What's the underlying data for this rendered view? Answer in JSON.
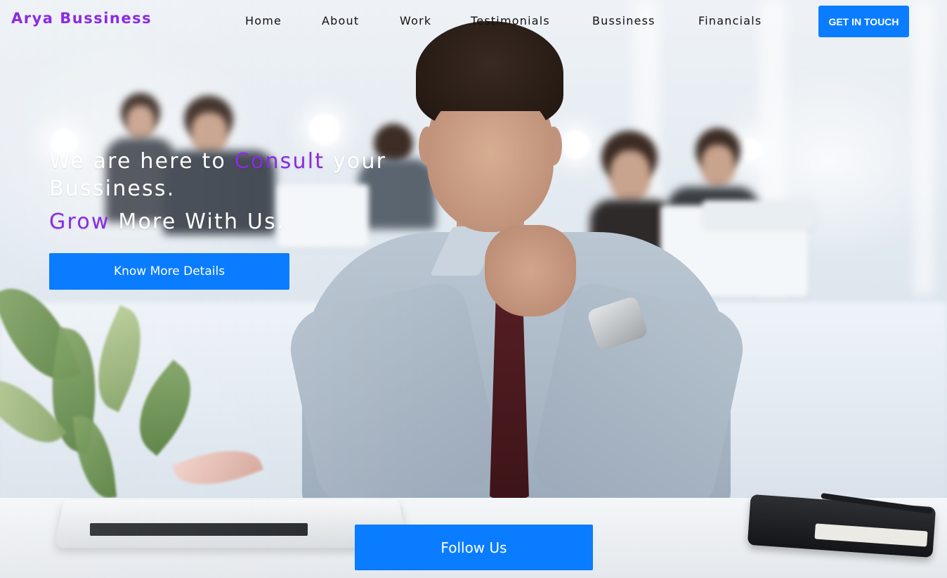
{
  "brand": {
    "name": "Arya Bussiness"
  },
  "nav": {
    "items": [
      {
        "label": "Home"
      },
      {
        "label": "About"
      },
      {
        "label": "Work"
      },
      {
        "label": "Testimonials"
      },
      {
        "label": "Bussiness"
      },
      {
        "label": "Financials"
      }
    ],
    "cta_label": "GET IN TOUCH"
  },
  "hero": {
    "line1_part1": "We are here to ",
    "line1_accent": "Consult",
    "line1_part2": " your Bussiness.",
    "line2_accent": "Grow",
    "line2_part2": " More With Us.",
    "details_button": "Know More Details",
    "follow_button": "Follow Us"
  },
  "colors": {
    "brand_purple": "#8a2be2",
    "button_blue": "#0a7cff",
    "nav_text": "#111111",
    "hero_text": "#ffffff"
  }
}
